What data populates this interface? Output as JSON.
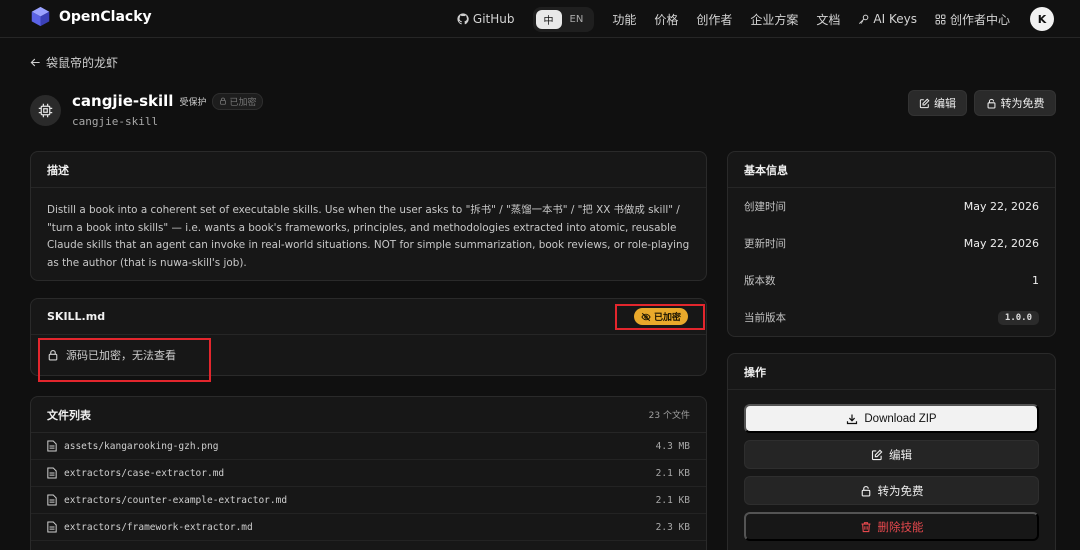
{
  "nav": {
    "brand": "OpenClacky",
    "github": "GitHub",
    "lang_zh": "中",
    "lang_en": "EN",
    "links": [
      "功能",
      "价格",
      "创作者",
      "企业方案",
      "文档"
    ],
    "ai_keys": "AI Keys",
    "creator_center": "创作者中心",
    "avatar_initial": "K"
  },
  "back": {
    "label": "袋鼠帝的龙虾"
  },
  "skill": {
    "title": "cangjie-skill",
    "protected": "受保护",
    "encrypted_chip": "已加密",
    "slug": "cangjie-skill",
    "edit_label": "编辑",
    "free_label": "转为免费"
  },
  "description": {
    "title": "描述",
    "text": "Distill a book into a coherent set of executable skills. Use when the user asks to \"拆书\" / \"蒸馏一本书\" / \"把 XX 书做成 skill\" / \"turn a book into skills\" — i.e. wants a book's frameworks, principles, and methodologies extracted into atomic, reusable Claude skills that an agent can invoke in real-world situations. NOT for simple summarization, book reviews, or role-playing as the author (that is nuwa-skill's job)."
  },
  "skillmd": {
    "title": "SKILL.md",
    "badge": "已加密",
    "locked_text": "源码已加密，无法查看"
  },
  "files": {
    "title": "文件列表",
    "count": "23 个文件",
    "items": [
      {
        "name": "assets/kangarooking-gzh.png",
        "size": "4.3 MB"
      },
      {
        "name": "extractors/case-extractor.md",
        "size": "2.1 KB"
      },
      {
        "name": "extractors/counter-example-extractor.md",
        "size": "2.1 KB"
      },
      {
        "name": "extractors/framework-extractor.md",
        "size": "2.3 KB"
      }
    ]
  },
  "info": {
    "title": "基本信息",
    "rows": [
      {
        "label": "创建时间",
        "value": "May 22, 2026"
      },
      {
        "label": "更新时间",
        "value": "May 22, 2026"
      },
      {
        "label": "版本数",
        "value": "1"
      }
    ],
    "current_version_label": "当前版本",
    "current_version": "1.0.0"
  },
  "actions": {
    "title": "操作",
    "download": "Download ZIP",
    "edit": "编辑",
    "make_free": "转为免费",
    "delete": "删除技能"
  },
  "colors": {
    "accent_encrypted": "#e9a92b",
    "danger": "#e5484d",
    "highlight_box": "#e3262d"
  }
}
